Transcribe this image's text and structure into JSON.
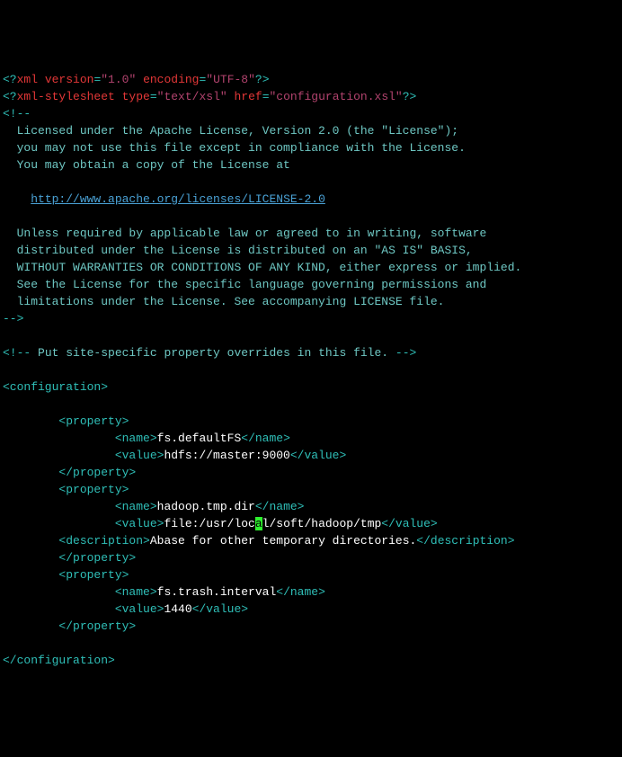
{
  "xml_decl": {
    "open": "<?",
    "kw": "xml version",
    "eq1": "=",
    "v1": "\"1.0\"",
    "enc_k": " encoding",
    "eq2": "=",
    "v2": "\"UTF-8\"",
    "close": "?>"
  },
  "stylesheet": {
    "open": "<?",
    "kw": "xml-stylesheet type",
    "eq1": "=",
    "v1": "\"text/xsl\"",
    "href_k": " href",
    "eq2": "=",
    "v2": "\"configuration.xsl\"",
    "close": "?>"
  },
  "license": {
    "open": "<!--",
    "l1": "  Licensed under the Apache License, Version 2.0 (the \"License\");",
    "l2": "  you may not use this file except in compliance with the License.",
    "l3": "  You may obtain a copy of the License at",
    "blank": "",
    "url_pad": "    ",
    "url": "http://www.apache.org/licenses/LICENSE-2.0",
    "l4": "  Unless required by applicable law or agreed to in writing, software",
    "l5": "  distributed under the License is distributed on an \"AS IS\" BASIS,",
    "l6": "  WITHOUT WARRANTIES OR CONDITIONS OF ANY KIND, either express or implied.",
    "l7": "  See the License for the specific language governing permissions and",
    "l8": "  limitations under the License. See accompanying LICENSE file.",
    "close": "-->"
  },
  "site_comment": {
    "open": "<!--",
    "body": " Put site-specific property overrides in this file. ",
    "close": "-->"
  },
  "tags": {
    "configuration_o": "<configuration>",
    "configuration_c": "</configuration>",
    "property_o": "<property>",
    "property_c": "</property>",
    "name_o": "<name>",
    "name_c": "</name>",
    "value_o": "<value>",
    "value_c": "</value>",
    "description_o": "<description>",
    "description_c": "</description>"
  },
  "p1": {
    "name": "fs.defaultFS",
    "value": "hdfs://master:9000"
  },
  "p2": {
    "name": "hadoop.tmp.dir",
    "value_pre": "file:/usr/loc",
    "cursor": "a",
    "value_post": "l/soft/hadoop/tmp",
    "description": "Abase for other temporary directories."
  },
  "p3": {
    "name": "fs.trash.interval",
    "value": "1440"
  },
  "indent": {
    "i8": "        ",
    "i16": "                "
  }
}
